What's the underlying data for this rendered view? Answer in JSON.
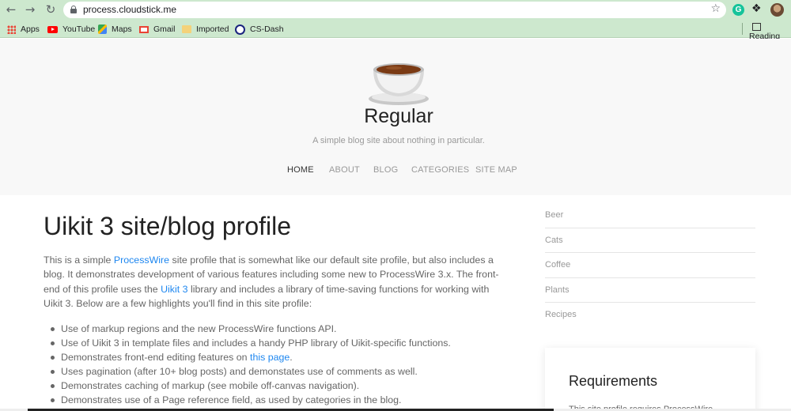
{
  "browser": {
    "url": "process.cloudstick.me",
    "bookmarks": [
      "Apps",
      "YouTube",
      "Maps",
      "Gmail",
      "Imported",
      "CS-Dash"
    ],
    "reading_list": "Reading",
    "extension_letter": "G"
  },
  "site": {
    "title": "Regular",
    "tagline": "A simple blog site about nothing in particular.",
    "nav": [
      "HOME",
      "ABOUT",
      "BLOG",
      "CATEGORIES",
      "SITE MAP"
    ],
    "active_nav": "HOME"
  },
  "main": {
    "title": "Uikit 3 site/blog profile",
    "intro": {
      "p1": "This is a simple ",
      "link1": "ProcessWire",
      "p2": " site profile that is somewhat like our default site profile, but also includes a blog. It demonstrates development of various features including some new to ProcessWire 3.x. The front-end of this profile uses the ",
      "link2": "Uikit 3",
      "p3": " library and includes a library of time-saving functions for working with Uikit 3. Below are a few highlights you'll find in this site profile:"
    },
    "features": [
      "Use of markup regions and the new ProcessWire functions API.",
      "Use of Uikit 3 in template files and includes a handy PHP library of Uikit-specific functions.",
      "Demonstrates front-end editing features on ",
      "Uses pagination (after 10+ blog posts) and demonstates use of comments as well.",
      "Demonstrates caching of markup (see mobile off-canvas navigation).",
      "Demonstrates use of a Page reference field, as used by categories in the blog."
    ],
    "feature_link": "this page",
    "feature_link_suffix": "."
  },
  "sidebar": {
    "categories": [
      "Beer",
      "Cats",
      "Coffee",
      "Plants",
      "Recipes"
    ],
    "requirements_title": "Requirements",
    "requirements_text": "This site profile requires ProcessWire"
  },
  "colors": {
    "chrome": "#cde8ce",
    "header_bg": "#f8f8f8",
    "link": "#1e87f0"
  }
}
